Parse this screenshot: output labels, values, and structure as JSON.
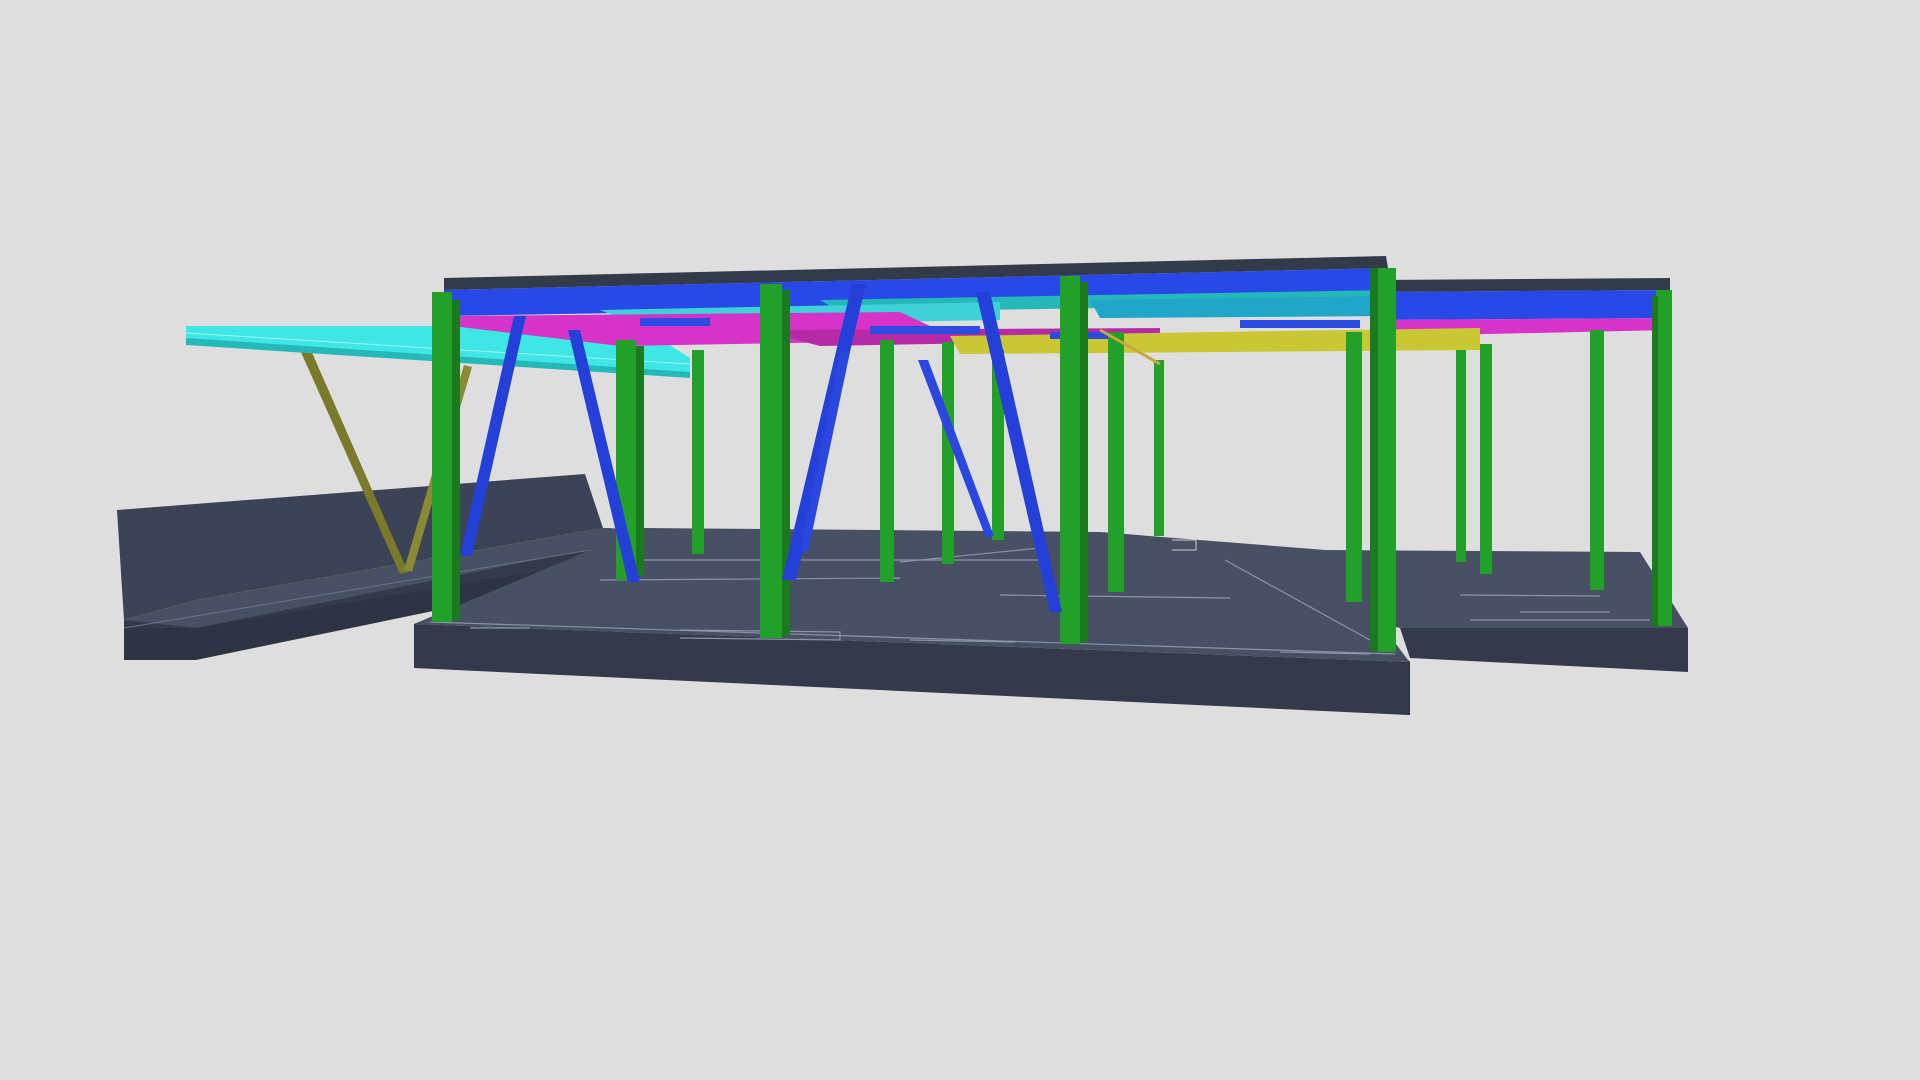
{
  "viewer": {
    "background": "#dedede"
  },
  "model": {
    "colors": {
      "slab_top": "#485064",
      "slab_side": "#343a4c",
      "slab_line": "#8a93a8",
      "wall": "#3c4356",
      "column": "#23a02a",
      "column_dark": "#1b7a20",
      "brace": "#2540d8",
      "main_beam": "#2848e8",
      "deck_cyan": "#3fe6e6",
      "deck_teal": "#25b8b8",
      "beam_magenta": "#d633c8",
      "beam_yellow": "#c9c734",
      "canopy_strut": "#7a7a2a",
      "roof_edge": "#333a4a"
    }
  }
}
